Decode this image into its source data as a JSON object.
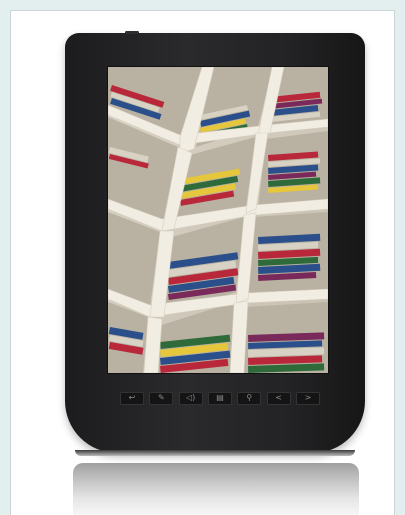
{
  "device": {
    "type": "e-reader",
    "body_color": "#232325",
    "screen_content": "bookshelf photo",
    "buttons": [
      {
        "name": "back-icon",
        "glyph": "↩"
      },
      {
        "name": "edit-icon",
        "glyph": "✎"
      },
      {
        "name": "volume-icon",
        "glyph": "◁)"
      },
      {
        "name": "menu-icon",
        "glyph": "▤"
      },
      {
        "name": "search-icon",
        "glyph": "⚲"
      },
      {
        "name": "previous-page-icon",
        "glyph": "<"
      },
      {
        "name": "next-page-icon",
        "glyph": ">"
      }
    ]
  },
  "colors": {
    "page_background": "#e3eeef",
    "shelf_wood": "#f2ede3",
    "book_colors": [
      "#b8283a",
      "#2a4f8a",
      "#e6c63a",
      "#2f6b3a",
      "#d8d2c4",
      "#7a2a5a"
    ]
  }
}
